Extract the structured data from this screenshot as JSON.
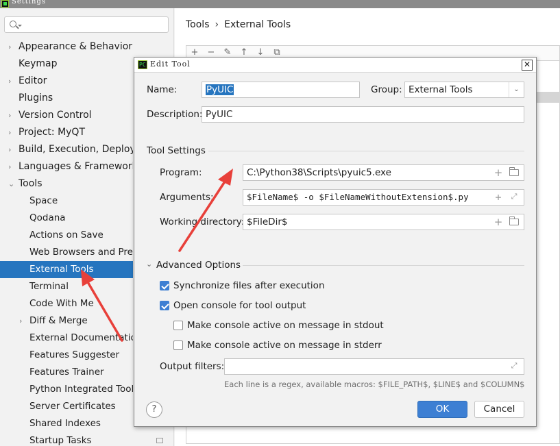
{
  "window": {
    "title": "Settings"
  },
  "search": {
    "placeholder": ""
  },
  "sidebar": {
    "items": [
      {
        "label": "Appearance & Behavior",
        "level": 0,
        "expandable": true,
        "chevron": "›"
      },
      {
        "label": "Keymap",
        "level": 0,
        "expandable": false,
        "chevron": ""
      },
      {
        "label": "Editor",
        "level": 0,
        "expandable": true,
        "chevron": "›"
      },
      {
        "label": "Plugins",
        "level": 0,
        "expandable": false,
        "chevron": ""
      },
      {
        "label": "Version Control",
        "level": 0,
        "expandable": true,
        "chevron": "›"
      },
      {
        "label": "Project: MyQT",
        "level": 0,
        "expandable": true,
        "chevron": "›"
      },
      {
        "label": "Build, Execution, Deployment",
        "level": 0,
        "expandable": true,
        "chevron": "›"
      },
      {
        "label": "Languages & Frameworks",
        "level": 0,
        "expandable": true,
        "chevron": "›"
      },
      {
        "label": "Tools",
        "level": 0,
        "expandable": true,
        "chevron": "⌄"
      },
      {
        "label": "Space",
        "level": 1,
        "expandable": false,
        "chevron": ""
      },
      {
        "label": "Qodana",
        "level": 1,
        "expandable": false,
        "chevron": ""
      },
      {
        "label": "Actions on Save",
        "level": 1,
        "expandable": false,
        "chevron": ""
      },
      {
        "label": "Web Browsers and Preview",
        "level": 1,
        "expandable": false,
        "chevron": ""
      },
      {
        "label": "External Tools",
        "level": 1,
        "expandable": false,
        "chevron": "",
        "selected": true
      },
      {
        "label": "Terminal",
        "level": 1,
        "expandable": false,
        "chevron": ""
      },
      {
        "label": "Code With Me",
        "level": 1,
        "expandable": false,
        "chevron": ""
      },
      {
        "label": "Diff & Merge",
        "level": 1,
        "expandable": true,
        "chevron": "›"
      },
      {
        "label": "External Documentation",
        "level": 1,
        "expandable": false,
        "chevron": ""
      },
      {
        "label": "Features Suggester",
        "level": 1,
        "expandable": false,
        "chevron": ""
      },
      {
        "label": "Features Trainer",
        "level": 1,
        "expandable": false,
        "chevron": ""
      },
      {
        "label": "Python Integrated Tools",
        "level": 1,
        "expandable": false,
        "chevron": ""
      },
      {
        "label": "Server Certificates",
        "level": 1,
        "expandable": false,
        "chevron": ""
      },
      {
        "label": "Shared Indexes",
        "level": 1,
        "expandable": false,
        "chevron": ""
      },
      {
        "label": "Startup Tasks",
        "level": 1,
        "expandable": false,
        "chevron": ""
      }
    ]
  },
  "breadcrumb": {
    "parent": "Tools",
    "separator": "›",
    "current": "External Tools"
  },
  "toolbar": {
    "icons": [
      "+",
      "−",
      "✎",
      "↑",
      "↓",
      "⧉"
    ]
  },
  "dialog": {
    "title": "Edit Tool",
    "close_glyph": "✕",
    "name_label": "Name:",
    "name_value": "PyUIC",
    "group_label": "Group:",
    "group_value": "External Tools",
    "description_label": "Description:",
    "description_value": "PyUIC",
    "tool_settings_title": "Tool Settings",
    "program_label": "Program:",
    "program_value": "C:\\Python38\\Scripts\\pyuic5.exe",
    "arguments_label": "Arguments:",
    "arguments_value": "$FileName$ -o $FileNameWithoutExtension$.py",
    "working_dir_label": "Working directory:",
    "working_dir_value": "$FileDir$",
    "advanced_title": "Advanced Options",
    "sync_label": "Synchronize files after execution",
    "sync_checked": true,
    "console_label": "Open console for tool output",
    "console_checked": true,
    "stdout_label": "Make console active on message in stdout",
    "stdout_checked": false,
    "stderr_label": "Make console active on message in stderr",
    "stderr_checked": false,
    "output_filters_label": "Output filters:",
    "output_filters_value": "",
    "output_hint": "Each line is a regex, available macros: $FILE_PATH$, $LINE$ and $COLUMN$",
    "help_glyph": "?",
    "ok_label": "OK",
    "cancel_label": "Cancel"
  },
  "colors": {
    "accent": "#2675bf",
    "button_primary": "#3d7fd3",
    "annotation_arrow": "#e8403a"
  }
}
